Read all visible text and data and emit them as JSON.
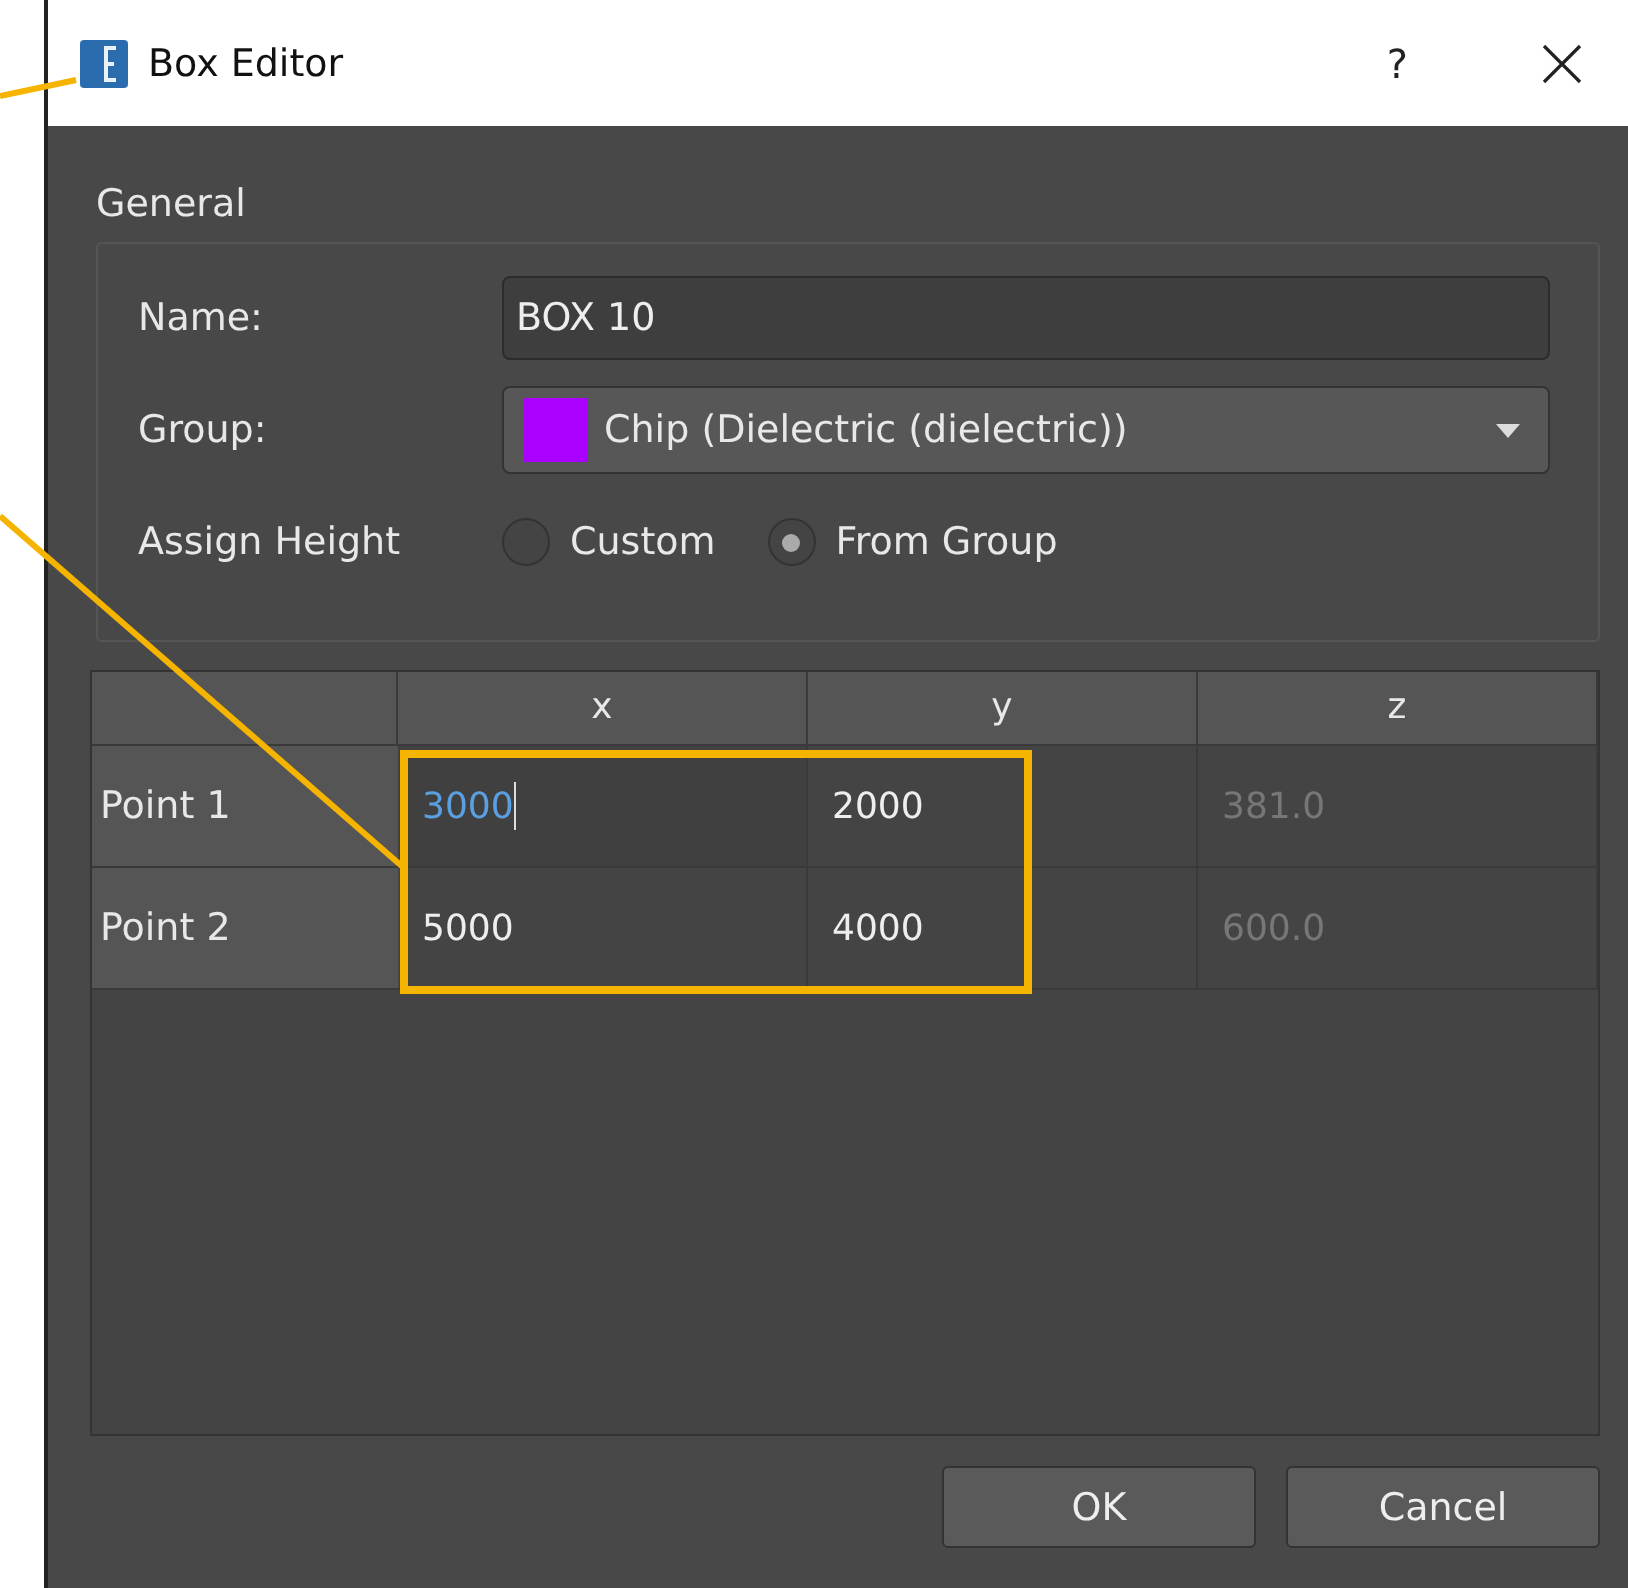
{
  "window": {
    "title": "Box Editor",
    "help": "?"
  },
  "general": {
    "title": "General",
    "name": {
      "label": "Name:",
      "value": "BOX 10"
    },
    "group": {
      "label": "Group:",
      "value": "Chip (Dielectric (dielectric))",
      "color": "#aa00ff"
    },
    "assign_height": {
      "label": "Assign Height",
      "options": [
        {
          "label": "Custom",
          "selected": false
        },
        {
          "label": "From Group",
          "selected": true
        }
      ]
    }
  },
  "table": {
    "columns": [
      "x",
      "y",
      "z"
    ],
    "rows": [
      {
        "label": "Point 1",
        "cells": [
          {
            "value": "3000",
            "editing": true,
            "disabled": false
          },
          {
            "value": "2000",
            "editing": false,
            "disabled": false
          },
          {
            "value": "381.0",
            "editing": false,
            "disabled": true
          }
        ]
      },
      {
        "label": "Point 2",
        "cells": [
          {
            "value": "5000",
            "editing": false,
            "disabled": false
          },
          {
            "value": "4000",
            "editing": false,
            "disabled": false
          },
          {
            "value": "600.0",
            "editing": false,
            "disabled": true
          }
        ]
      }
    ]
  },
  "buttons": [
    "OK",
    "Cancel"
  ]
}
